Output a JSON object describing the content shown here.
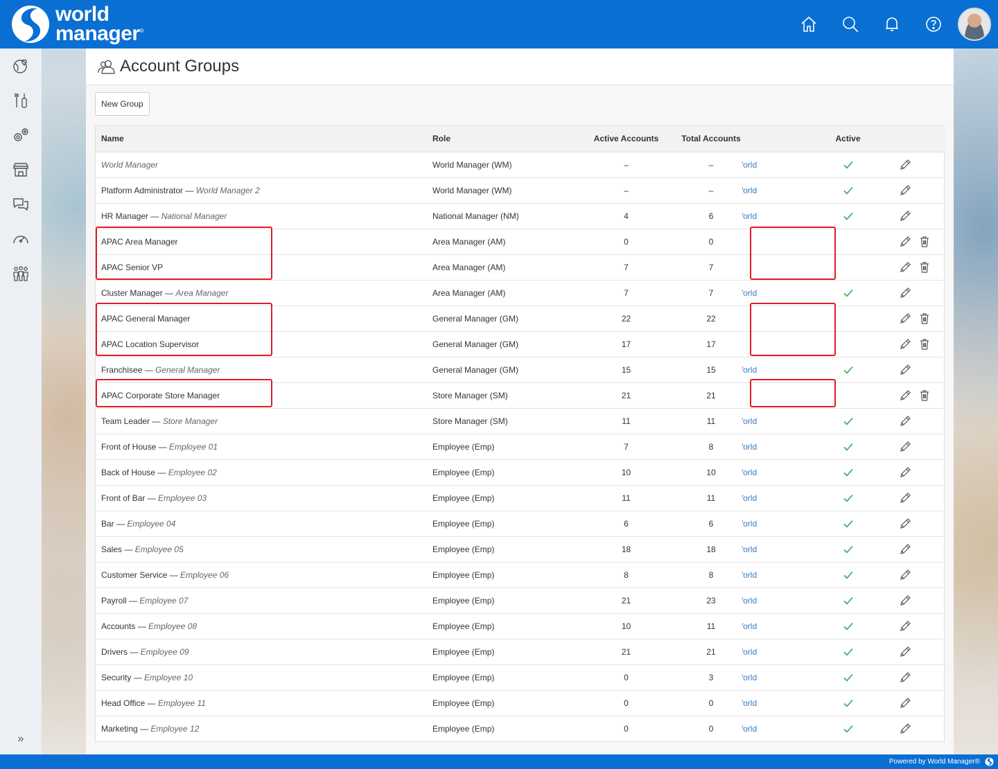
{
  "brand": {
    "line1": "world",
    "line2": "manager",
    "registered": "®"
  },
  "header_icons": [
    "home-icon",
    "search-icon",
    "bell-icon",
    "help-icon"
  ],
  "sidebar_icons": [
    "globe-pin-icon",
    "tools-icon",
    "gears-icon",
    "store-icon",
    "chat-icon",
    "gauge-icon",
    "people-icon"
  ],
  "expand_glyph": "»",
  "page": {
    "title": "Account Groups",
    "new_group_label": "New Group"
  },
  "table": {
    "columns": [
      "Name",
      "Role",
      "Active Accounts",
      "Total Accounts",
      "",
      "Active",
      ""
    ],
    "rows": [
      {
        "name": "",
        "parent": "World Manager",
        "role": "World Manager (WM)",
        "active": "–",
        "total": "–",
        "scope": "World",
        "is_active": true,
        "deletable": false
      },
      {
        "name": "Platform Administrator",
        "parent": "World Manager 2",
        "role": "World Manager (WM)",
        "active": "–",
        "total": "–",
        "scope": "World",
        "is_active": true,
        "deletable": false
      },
      {
        "name": "HR Manager",
        "parent": "National Manager",
        "role": "National Manager (NM)",
        "active": "4",
        "total": "6",
        "scope": "World",
        "is_active": true,
        "deletable": false
      },
      {
        "name": "APAC Area Manager",
        "parent": "",
        "role": "Area Manager (AM)",
        "active": "0",
        "total": "0",
        "scope": "",
        "is_active": false,
        "deletable": true
      },
      {
        "name": "APAC Senior VP",
        "parent": "",
        "role": "Area Manager (AM)",
        "active": "7",
        "total": "7",
        "scope": "",
        "is_active": false,
        "deletable": true
      },
      {
        "name": "Cluster Manager",
        "parent": "Area Manager",
        "role": "Area Manager (AM)",
        "active": "7",
        "total": "7",
        "scope": "World",
        "is_active": true,
        "deletable": false
      },
      {
        "name": "APAC General Manager",
        "parent": "",
        "role": "General Manager (GM)",
        "active": "22",
        "total": "22",
        "scope": "",
        "is_active": false,
        "deletable": true
      },
      {
        "name": "APAC Location Supervisor",
        "parent": "",
        "role": "General Manager (GM)",
        "active": "17",
        "total": "17",
        "scope": "",
        "is_active": false,
        "deletable": true
      },
      {
        "name": "Franchisee",
        "parent": "General Manager",
        "role": "General Manager (GM)",
        "active": "15",
        "total": "15",
        "scope": "World",
        "is_active": true,
        "deletable": false
      },
      {
        "name": "APAC Corporate Store Manager",
        "parent": "",
        "role": "Store Manager (SM)",
        "active": "21",
        "total": "21",
        "scope": "",
        "is_active": false,
        "deletable": true
      },
      {
        "name": "Team Leader",
        "parent": "Store Manager",
        "role": "Store Manager (SM)",
        "active": "11",
        "total": "11",
        "scope": "World",
        "is_active": true,
        "deletable": false
      },
      {
        "name": "Front of House",
        "parent": "Employee 01",
        "role": "Employee (Emp)",
        "active": "7",
        "total": "8",
        "scope": "World",
        "is_active": true,
        "deletable": false
      },
      {
        "name": "Back of House",
        "parent": "Employee 02",
        "role": "Employee (Emp)",
        "active": "10",
        "total": "10",
        "scope": "World",
        "is_active": true,
        "deletable": false
      },
      {
        "name": "Front of Bar",
        "parent": "Employee 03",
        "role": "Employee (Emp)",
        "active": "11",
        "total": "11",
        "scope": "World",
        "is_active": true,
        "deletable": false
      },
      {
        "name": "Bar",
        "parent": "Employee 04",
        "role": "Employee (Emp)",
        "active": "6",
        "total": "6",
        "scope": "World",
        "is_active": true,
        "deletable": false
      },
      {
        "name": "Sales",
        "parent": "Employee 05",
        "role": "Employee (Emp)",
        "active": "18",
        "total": "18",
        "scope": "World",
        "is_active": true,
        "deletable": false
      },
      {
        "name": "Customer Service",
        "parent": "Employee 06",
        "role": "Employee (Emp)",
        "active": "8",
        "total": "8",
        "scope": "World",
        "is_active": true,
        "deletable": false
      },
      {
        "name": "Payroll",
        "parent": "Employee 07",
        "role": "Employee (Emp)",
        "active": "21",
        "total": "23",
        "scope": "World",
        "is_active": true,
        "deletable": false
      },
      {
        "name": "Accounts",
        "parent": "Employee 08",
        "role": "Employee (Emp)",
        "active": "10",
        "total": "11",
        "scope": "World",
        "is_active": true,
        "deletable": false
      },
      {
        "name": "Drivers",
        "parent": "Employee 09",
        "role": "Employee (Emp)",
        "active": "21",
        "total": "21",
        "scope": "World",
        "is_active": true,
        "deletable": false
      },
      {
        "name": "Security",
        "parent": "Employee 10",
        "role": "Employee (Emp)",
        "active": "0",
        "total": "3",
        "scope": "World",
        "is_active": true,
        "deletable": false
      },
      {
        "name": "Head Office",
        "parent": "Employee 11",
        "role": "Employee (Emp)",
        "active": "0",
        "total": "0",
        "scope": "World",
        "is_active": true,
        "deletable": false
      },
      {
        "name": "Marketing",
        "parent": "Employee 12",
        "role": "Employee (Emp)",
        "active": "0",
        "total": "0",
        "scope": "World",
        "is_active": true,
        "deletable": false
      }
    ]
  },
  "footer": {
    "text": "Powered by World Manager®"
  },
  "colors": {
    "brand_blue": "#0a6fd3",
    "link_blue": "#3a7ac4",
    "check_green": "#3aa64a",
    "highlight_red": "#e31b23"
  }
}
